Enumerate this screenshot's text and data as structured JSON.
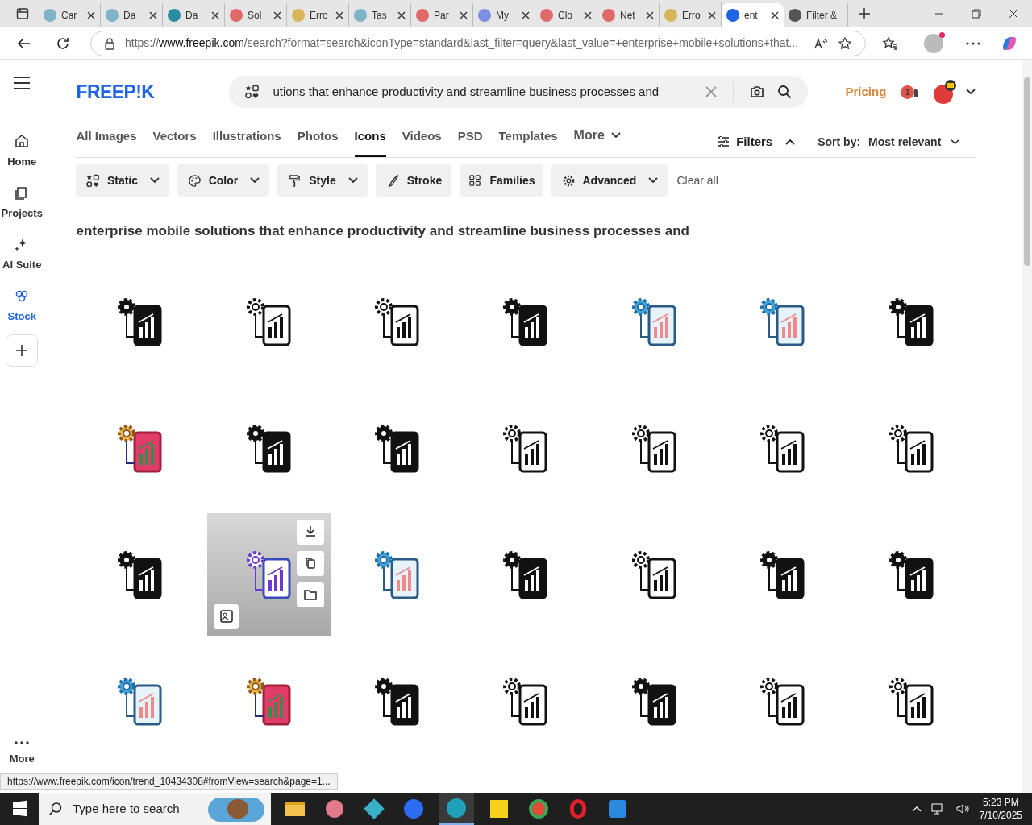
{
  "browser": {
    "tabs": [
      {
        "label": "Car",
        "selected": false,
        "color": "#7fb3c8"
      },
      {
        "label": "Da",
        "selected": false,
        "color": "#7fb3c8"
      },
      {
        "label": "Da",
        "selected": false,
        "color": "#2a8ca0"
      },
      {
        "label": "Sol",
        "selected": false,
        "color": "#e06a6a"
      },
      {
        "label": "Erro",
        "selected": false,
        "color": "#d8b45a"
      },
      {
        "label": "Tas",
        "selected": false,
        "color": "#7fb3c8"
      },
      {
        "label": "Par",
        "selected": false,
        "color": "#e06a6a"
      },
      {
        "label": "My",
        "selected": false,
        "color": "#7d8fe0"
      },
      {
        "label": "Clo",
        "selected": false,
        "color": "#e06a6a"
      },
      {
        "label": "Net",
        "selected": false,
        "color": "#e06a6a"
      },
      {
        "label": "Erro",
        "selected": false,
        "color": "#d8b45a"
      },
      {
        "label": "ent",
        "selected": true,
        "color": "#1f63e6"
      },
      {
        "label": "Filter &",
        "selected": false,
        "color": "#555555"
      }
    ],
    "url_prefix": "https://",
    "url_host": "www.freepik.com",
    "url_rest": "/search?format=search&iconType=standard&last_filter=query&last_value=+enterprise+mobile+solutions+that...",
    "status_url": "https://www.freepik.com/icon/trend_10434308#fromView=search&page=1..."
  },
  "sidebar": {
    "items": [
      {
        "label": "Home",
        "selected": false
      },
      {
        "label": "Projects",
        "selected": false
      },
      {
        "label": "AI Suite",
        "selected": false
      },
      {
        "label": "Stock",
        "selected": true
      }
    ],
    "more": "More"
  },
  "header": {
    "logo": "FREEP!K",
    "search_value": "utions that enhance productivity and streamline business processes and",
    "pricing": "Pricing",
    "notification_count": "1"
  },
  "categories": [
    {
      "label": "All Images",
      "selected": false
    },
    {
      "label": "Vectors",
      "selected": false
    },
    {
      "label": "Illustrations",
      "selected": false
    },
    {
      "label": "Photos",
      "selected": false
    },
    {
      "label": "Icons",
      "selected": true
    },
    {
      "label": "Videos",
      "selected": false
    },
    {
      "label": "PSD",
      "selected": false
    },
    {
      "label": "Templates",
      "selected": false
    },
    {
      "label": "More",
      "selected": false
    }
  ],
  "filters_toggle": {
    "label": "Filters",
    "expanded": true
  },
  "sort": {
    "label": "Sort by:",
    "value": "Most relevant"
  },
  "filter_buttons": [
    {
      "label": "Static",
      "dropdown": true
    },
    {
      "label": "Color",
      "dropdown": true
    },
    {
      "label": "Style",
      "dropdown": true
    },
    {
      "label": "Stroke",
      "dropdown": false
    },
    {
      "label": "Families",
      "dropdown": false
    },
    {
      "label": "Advanced",
      "dropdown": true
    }
  ],
  "clear_all": "Clear all",
  "query_title": "enterprise mobile solutions that enhance productivity and streamline business processes and",
  "results": [
    {
      "kind": "solid",
      "hovered": false
    },
    {
      "kind": "outline",
      "hovered": false
    },
    {
      "kind": "outline",
      "hovered": false
    },
    {
      "kind": "solid",
      "hovered": false
    },
    {
      "kind": "blue",
      "hovered": false
    },
    {
      "kind": "blue",
      "hovered": false
    },
    {
      "kind": "solid",
      "hovered": false
    },
    {
      "kind": "color",
      "hovered": false
    },
    {
      "kind": "solid",
      "hovered": false
    },
    {
      "kind": "solid",
      "hovered": false
    },
    {
      "kind": "outline",
      "hovered": false
    },
    {
      "kind": "outline",
      "hovered": false
    },
    {
      "kind": "outline",
      "hovered": false
    },
    {
      "kind": "outline",
      "hovered": false
    },
    {
      "kind": "solid",
      "hovered": false
    },
    {
      "kind": "purple",
      "hovered": true
    },
    {
      "kind": "blue",
      "hovered": false
    },
    {
      "kind": "solid",
      "hovered": false
    },
    {
      "kind": "outline",
      "hovered": false
    },
    {
      "kind": "solid",
      "hovered": false
    },
    {
      "kind": "solid",
      "hovered": false
    },
    {
      "kind": "blue",
      "hovered": false
    },
    {
      "kind": "color",
      "hovered": false
    },
    {
      "kind": "solid",
      "hovered": false
    },
    {
      "kind": "outline",
      "hovered": false
    },
    {
      "kind": "solid",
      "hovered": false
    },
    {
      "kind": "outline",
      "hovered": false
    },
    {
      "kind": "outline",
      "hovered": false
    }
  ],
  "taskbar": {
    "search_placeholder": "Type here to search",
    "time": "5:23 PM",
    "date": "7/10/2025"
  }
}
